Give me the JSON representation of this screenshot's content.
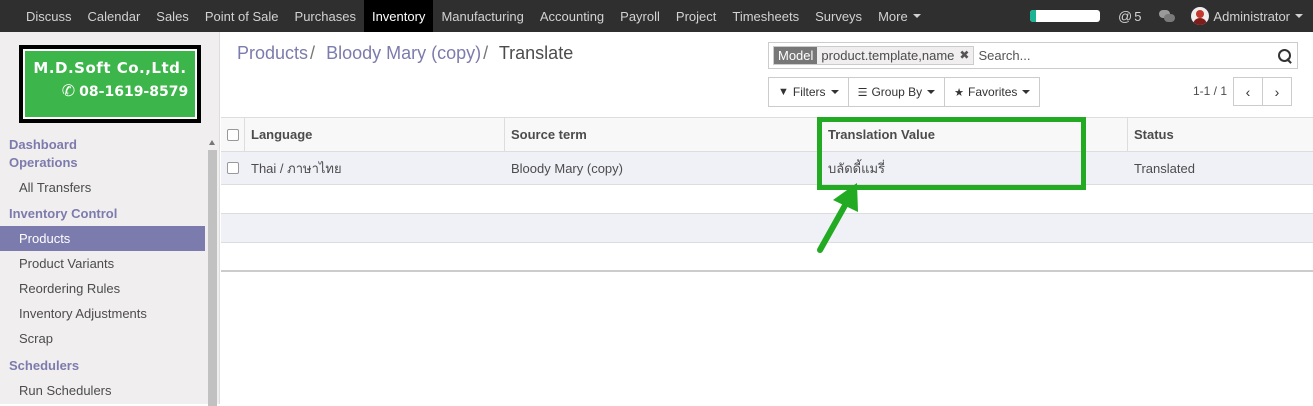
{
  "topbar": {
    "menu": [
      {
        "label": "Discuss"
      },
      {
        "label": "Calendar"
      },
      {
        "label": "Sales"
      },
      {
        "label": "Point of Sale"
      },
      {
        "label": "Purchases"
      },
      {
        "label": "Inventory",
        "active": true
      },
      {
        "label": "Manufacturing"
      },
      {
        "label": "Accounting"
      },
      {
        "label": "Payroll"
      },
      {
        "label": "Project"
      },
      {
        "label": "Timesheets"
      },
      {
        "label": "Surveys"
      },
      {
        "label": "More"
      }
    ],
    "messages_count": "5",
    "user": "Administrator",
    "progress": 0.08
  },
  "logo": {
    "company": "M.D.Soft Co.,Ltd.",
    "phone": "08-1619-8579"
  },
  "sidebar": {
    "sections": [
      {
        "title": "Dashboard Operations",
        "items": [
          "All Transfers"
        ]
      },
      {
        "title": "Inventory Control",
        "items": [
          "Products",
          "Product Variants",
          "Reordering Rules",
          "Inventory Adjustments",
          "Scrap"
        ]
      },
      {
        "title": "Schedulers",
        "items": [
          "Run Schedulers"
        ]
      }
    ],
    "active_item": "Products"
  },
  "breadcrumb": {
    "items": [
      "Products",
      "Bloody Mary (copy)"
    ],
    "current": "Translate"
  },
  "search": {
    "facet_label": "Model",
    "facet_value": "product.template,name",
    "placeholder": "Search..."
  },
  "buttons": {
    "filters": "Filters",
    "group_by": "Group By",
    "favorites": "Favorites"
  },
  "pager": {
    "text": "1-1 / 1"
  },
  "table": {
    "columns": [
      "Language",
      "Source term",
      "Translation Value",
      "Status"
    ],
    "rows": [
      {
        "language": "Thai / ภาษาไทย",
        "source": "Bloody Mary (copy)",
        "value": "บลัดดี้แมรี่",
        "status": "Translated"
      }
    ]
  },
  "colors": {
    "accent": "#7c7bad",
    "highlight": "#22aa22",
    "topbar": "#2f2f2f"
  }
}
